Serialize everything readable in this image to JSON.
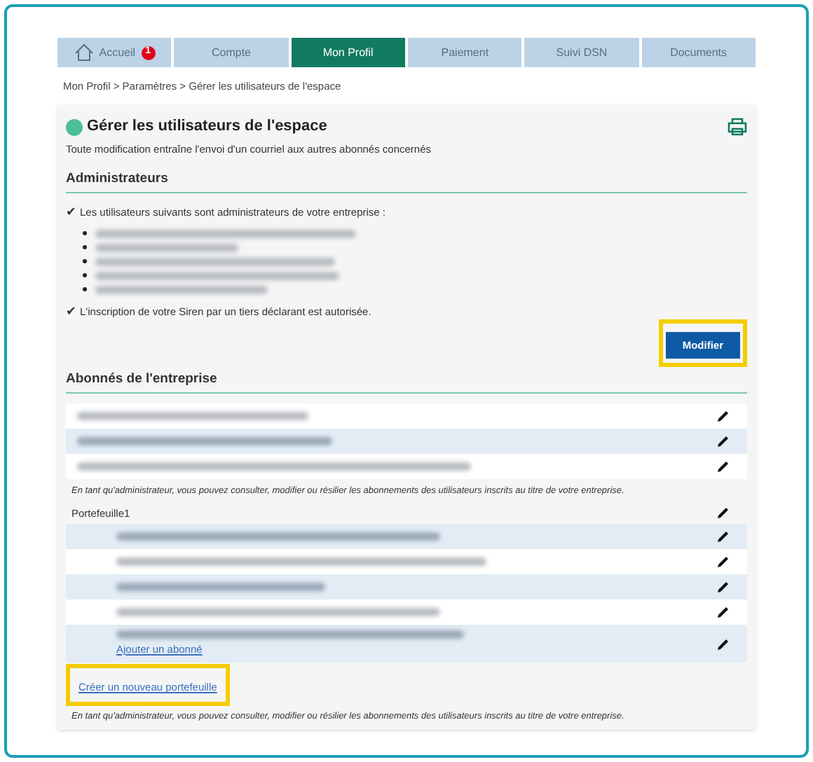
{
  "tabs": [
    {
      "label": "Accueil",
      "badge": "1",
      "selected": false
    },
    {
      "label": "Compte",
      "selected": false
    },
    {
      "label": "Mon Profil",
      "selected": true
    },
    {
      "label": "Paiement",
      "selected": false
    },
    {
      "label": "Suivi DSN",
      "selected": false
    },
    {
      "label": "Documents",
      "selected": false
    }
  ],
  "breadcrumb": "Mon Profil > Paramètres > Gérer les utilisateurs de l'espace",
  "page": {
    "title": "Gérer les utilisateurs de l'espace",
    "subtitle": "Toute modification entraîne l'envoi d'un courriel aux autres abonnés concernés"
  },
  "administrators": {
    "heading": "Administrateurs",
    "check": "✔",
    "intro": "Les utilisateurs suivants sont administrateurs de votre entreprise :",
    "entries": [
      {
        "kind": "redacted"
      },
      {
        "kind": "redacted"
      },
      {
        "kind": "redacted"
      },
      {
        "kind": "redacted"
      },
      {
        "kind": "redacted"
      }
    ],
    "siren_note": "L'inscription de votre Siren par un tiers déclarant est autorisée.",
    "button": {
      "label": "Modifier",
      "highlighted": true
    }
  },
  "subscribers": {
    "heading": "Abonnés de l'entreprise",
    "rows": [
      {
        "shaded": false
      },
      {
        "shaded": true
      },
      {
        "shaded": false
      }
    ],
    "note": "En tant qu'administrateur, vous pouvez consulter, modifier ou résilier les abonnements des utilisateurs inscrits au titre de votre entreprise.",
    "portfolio": {
      "label": "Portefeuille1",
      "rows": [
        {
          "shaded": true
        },
        {
          "shaded": false
        },
        {
          "shaded": true
        },
        {
          "shaded": false
        },
        {
          "shaded": true
        }
      ],
      "add_link": "Ajouter un abonné"
    },
    "create_link": {
      "label": "Créer un nouveau portefeuille",
      "highlighted": true
    },
    "note_2": "En tant qu'administrateur, vous pouvez consulter, modifier ou résilier les abonnements des utilisateurs inscrits au titre de votre entreprise."
  }
}
